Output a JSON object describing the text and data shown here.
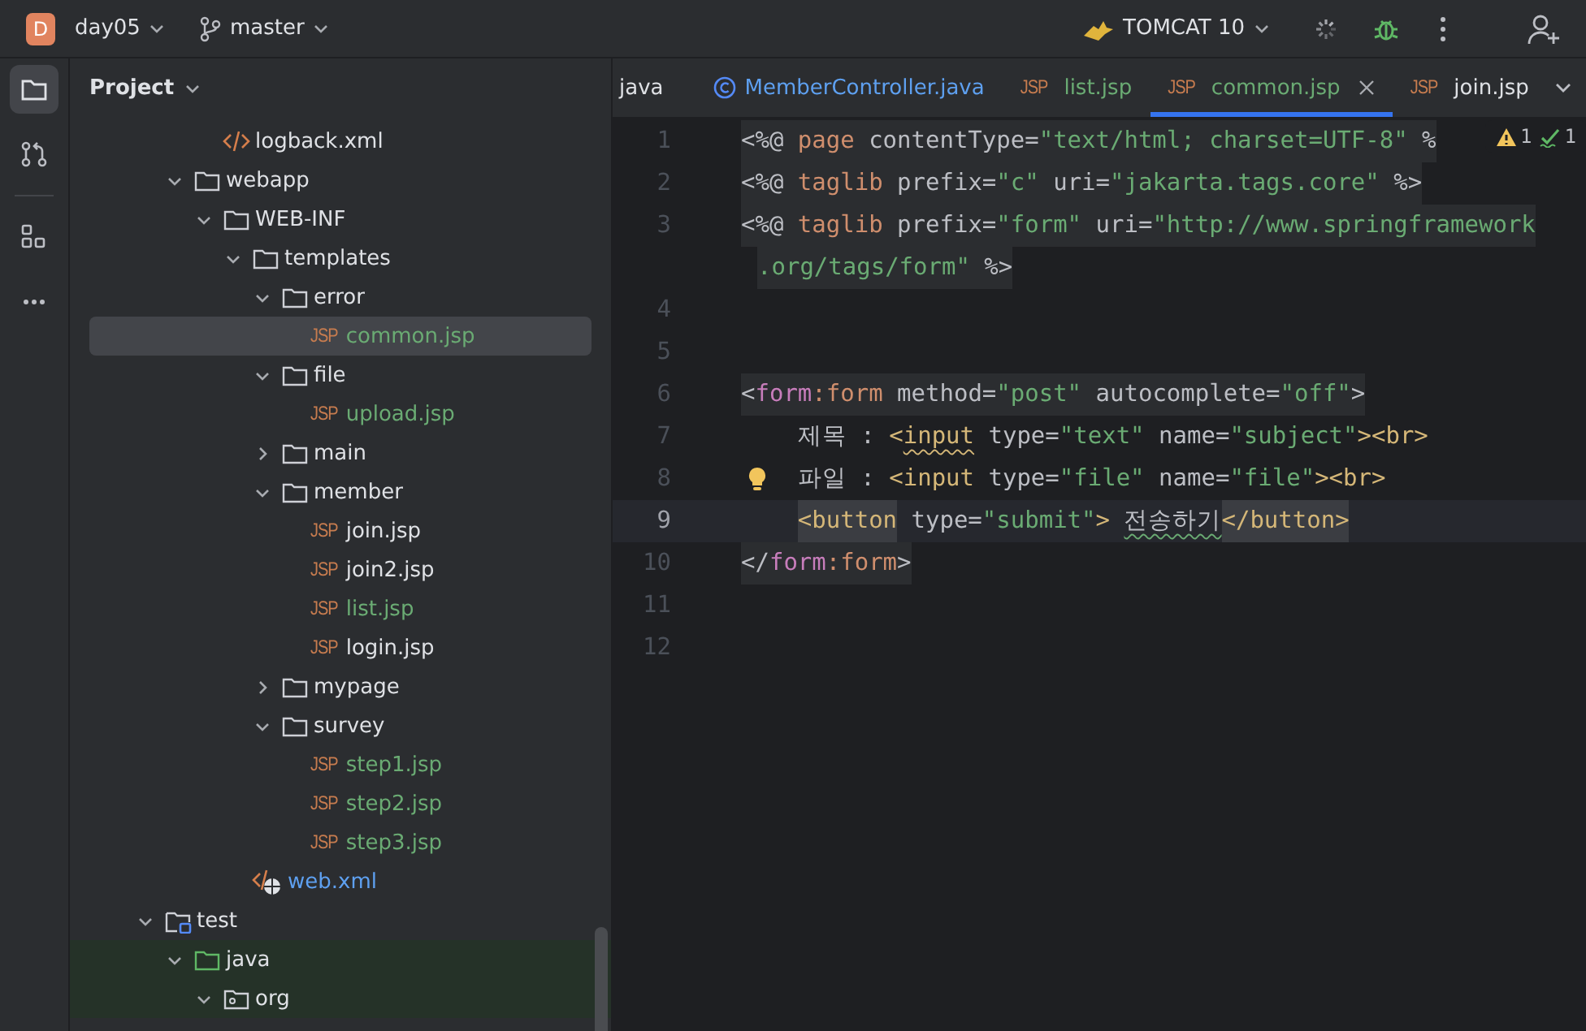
{
  "title_bar": {
    "project_initial": "D",
    "project": "day05",
    "branch": "master",
    "run_config": "TOMCAT 10"
  },
  "tool_strip": [
    {
      "kind": "project",
      "selected": true
    },
    {
      "kind": "commit",
      "selected": false
    },
    {
      "kind": "structure",
      "selected": false
    },
    {
      "kind": "more",
      "selected": false
    }
  ],
  "project_panel": {
    "title": "Project",
    "tree": [
      {
        "children": [
          {
            "children": [
              {
                "label": "logback.xml",
                "kind": "xml",
                "color": "#dfe1e5",
                "selected": false
              }
            ]
          },
          {
            "label": "webapp",
            "kind": "folder",
            "expanded": true,
            "color": "#dfe1e5",
            "selected": false,
            "children": [
              {
                "label": "WEB-INF",
                "kind": "folder",
                "expanded": true,
                "color": "#dfe1e5",
                "selected": false,
                "children": [
                  {
                    "label": "templates",
                    "kind": "folder",
                    "expanded": true,
                    "color": "#dfe1e5",
                    "selected": false,
                    "children": [
                      {
                        "label": "error",
                        "kind": "folder",
                        "expanded": true,
                        "color": "#dfe1e5",
                        "selected": false,
                        "children": [
                          {
                            "label": "common.jsp",
                            "kind": "jsp",
                            "badge": "JSP",
                            "color": "#6aab73",
                            "selected": true
                          }
                        ]
                      },
                      {
                        "label": "file",
                        "kind": "folder",
                        "expanded": true,
                        "color": "#dfe1e5",
                        "selected": false,
                        "children": [
                          {
                            "label": "upload.jsp",
                            "kind": "jsp",
                            "badge": "JSP",
                            "color": "#6aab73",
                            "selected": false
                          }
                        ]
                      },
                      {
                        "label": "main",
                        "kind": "folder",
                        "expanded": false,
                        "color": "#dfe1e5",
                        "selected": false
                      },
                      {
                        "label": "member",
                        "kind": "folder",
                        "expanded": true,
                        "color": "#dfe1e5",
                        "selected": false,
                        "children": [
                          {
                            "label": "join.jsp",
                            "kind": "jsp",
                            "badge": "JSP",
                            "color": "#dfe1e5",
                            "selected": false
                          },
                          {
                            "label": "join2.jsp",
                            "kind": "jsp",
                            "badge": "JSP",
                            "color": "#dfe1e5",
                            "selected": false
                          },
                          {
                            "label": "list.jsp",
                            "kind": "jsp",
                            "badge": "JSP",
                            "color": "#6aab73",
                            "selected": false
                          },
                          {
                            "label": "login.jsp",
                            "kind": "jsp",
                            "badge": "JSP",
                            "color": "#dfe1e5",
                            "selected": false
                          }
                        ]
                      },
                      {
                        "label": "mypage",
                        "kind": "folder",
                        "expanded": false,
                        "color": "#dfe1e5",
                        "selected": false
                      },
                      {
                        "label": "survey",
                        "kind": "folder",
                        "expanded": true,
                        "color": "#dfe1e5",
                        "selected": false,
                        "children": [
                          {
                            "label": "step1.jsp",
                            "kind": "jsp",
                            "badge": "JSP",
                            "color": "#6aab73",
                            "selected": false
                          },
                          {
                            "label": "step2.jsp",
                            "kind": "jsp",
                            "badge": "JSP",
                            "color": "#6aab73",
                            "selected": false
                          },
                          {
                            "label": "step3.jsp",
                            "kind": "jsp",
                            "badge": "JSP",
                            "color": "#6aab73",
                            "selected": false
                          }
                        ]
                      }
                    ]
                  },
                  {
                    "label": "web.xml",
                    "kind": "webxml",
                    "color": "#5ea0f0",
                    "selected": false
                  }
                ]
              }
            ]
          }
        ]
      },
      {
        "label": "test",
        "kind": "test-root",
        "expanded": true,
        "color": "#dfe1e5",
        "selected": false,
        "children": [
          {
            "label": "java",
            "kind": "source-root",
            "expanded": true,
            "color": "#dfe1e5",
            "selected": false,
            "test_scope": true,
            "children": [
              {
                "label": "org",
                "kind": "package",
                "expanded": true,
                "color": "#dfe1e5",
                "selected": false,
                "test_scope": true
              }
            ]
          }
        ]
      }
    ]
  },
  "tabs": [
    {
      "label": "java",
      "kind": "plain",
      "color": "#dfe1e5",
      "selected": false
    },
    {
      "label": "MemberController.java",
      "kind": "class",
      "color": "#5ea0f0",
      "selected": false
    },
    {
      "label": "list.jsp",
      "kind": "jsp",
      "badge": "JSP",
      "color": "#6aab73",
      "selected": false
    },
    {
      "label": "common.jsp",
      "kind": "jsp",
      "badge": "JSP",
      "color": "#6aab73",
      "selected": true
    },
    {
      "label": "join.jsp",
      "kind": "jsp",
      "badge": "JSP",
      "color": "#dfe1e5",
      "selected": false
    }
  ],
  "inspections": {
    "warnings": "1",
    "typos": "1"
  },
  "editor": {
    "lines": [
      {
        "number": "1",
        "current": false,
        "block": true,
        "tokens": [
          {
            "t": "<%@ ",
            "kind": "punct"
          },
          {
            "t": "page",
            "kind": "keyword"
          },
          {
            "t": " contentType=",
            "kind": "attr"
          },
          {
            "t": "\"text/html; charset=UTF-8\"",
            "kind": "string"
          },
          {
            "t": " %",
            "kind": "attr"
          }
        ]
      },
      {
        "number": "2",
        "current": false,
        "block": true,
        "tokens": [
          {
            "t": "<%@ ",
            "kind": "punct"
          },
          {
            "t": "taglib",
            "kind": "keyword"
          },
          {
            "t": " prefix=",
            "kind": "attr"
          },
          {
            "t": "\"c\"",
            "kind": "string"
          },
          {
            "t": " uri=",
            "kind": "attr"
          },
          {
            "t": "\"jakarta.tags.core\"",
            "kind": "string"
          },
          {
            "t": " %>",
            "kind": "attr"
          }
        ]
      },
      {
        "number": "3",
        "current": false,
        "block": true,
        "tokens": [
          {
            "t": "<%@ ",
            "kind": "punct"
          },
          {
            "t": "taglib",
            "kind": "keyword"
          },
          {
            "t": " prefix=",
            "kind": "attr"
          },
          {
            "t": "\"form\"",
            "kind": "string"
          },
          {
            "t": " uri=",
            "kind": "attr"
          },
          {
            "t": "\"http://www.springframework",
            "kind": "string"
          },
          {
            "t": ".org/tags/form\"",
            "kind": "string",
            "wrap": true
          },
          {
            "t": " %>",
            "kind": "attr"
          }
        ]
      },
      {
        "number": "4",
        "current": false
      },
      {
        "number": "5",
        "current": false
      },
      {
        "number": "6",
        "current": false,
        "block": true,
        "tokens": [
          {
            "t": "<",
            "kind": "punct"
          },
          {
            "t": "form",
            "kind": "ns"
          },
          {
            "t": ":form",
            "kind": "keyword"
          },
          {
            "t": " method=",
            "kind": "attr"
          },
          {
            "t": "\"post\"",
            "kind": "string"
          },
          {
            "t": " autocomplete=",
            "kind": "attr"
          },
          {
            "t": "\"off\"",
            "kind": "string"
          },
          {
            "t": ">",
            "kind": "punct"
          }
        ]
      },
      {
        "number": "7",
        "current": false,
        "tokens": [
          {
            "t": "    제목 : ",
            "kind": "text"
          },
          {
            "t": "<",
            "kind": "tag"
          },
          {
            "t": "input",
            "kind": "tag",
            "squiggle": true
          },
          {
            "t": " type=",
            "kind": "attr"
          },
          {
            "t": "\"text\"",
            "kind": "string"
          },
          {
            "t": " name=",
            "kind": "attr"
          },
          {
            "t": "\"subject\"",
            "kind": "string"
          },
          {
            "t": "><br>",
            "kind": "tag"
          }
        ]
      },
      {
        "number": "8",
        "current": false,
        "hint": true,
        "tokens": [
          {
            "t": "    파일 : ",
            "kind": "text"
          },
          {
            "t": "<input",
            "kind": "tag"
          },
          {
            "t": " type=",
            "kind": "attr"
          },
          {
            "t": "\"file\"",
            "kind": "string"
          },
          {
            "t": " name=",
            "kind": "attr"
          },
          {
            "t": "\"file\"",
            "kind": "string"
          },
          {
            "t": "><br>",
            "kind": "tag"
          }
        ]
      },
      {
        "number": "9",
        "current": true,
        "tokens": [
          {
            "t": "    <button",
            "kind": "tag",
            "match": true
          },
          {
            "t": " type=",
            "kind": "attr"
          },
          {
            "t": "\"submit\"",
            "kind": "string"
          },
          {
            "t": "> ",
            "kind": "tag"
          },
          {
            "t": "전송하기",
            "kind": "text",
            "squiggle": true
          },
          {
            "t": "</button>",
            "kind": "tag",
            "match": true
          }
        ]
      },
      {
        "number": "10",
        "current": false,
        "block": true,
        "tokens": [
          {
            "t": "</",
            "kind": "punct"
          },
          {
            "t": "form",
            "kind": "ns"
          },
          {
            "t": ":form",
            "kind": "keyword"
          },
          {
            "t": ">",
            "kind": "punct"
          }
        ]
      },
      {
        "number": "11",
        "current": false
      },
      {
        "number": "12",
        "current": false
      }
    ]
  }
}
